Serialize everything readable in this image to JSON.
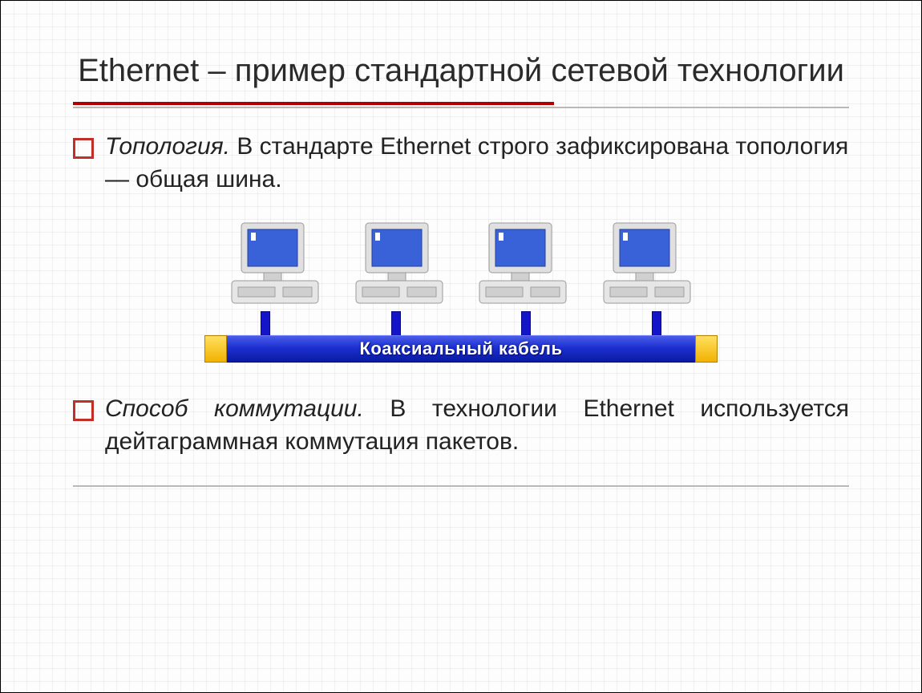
{
  "slide": {
    "title": "Ethernet – пример стандартной сетевой технологии",
    "bullet1": {
      "lead": "Топология.",
      "rest": " В стандарте Ethernet строго зафиксирована топология — общая шина."
    },
    "diagram": {
      "bus_label": "Коаксиальный кабель"
    },
    "bullet2": {
      "lead": "Способ коммутации.",
      "rest": " В технологии Ethernet используется дейтаграммная коммутация пакетов."
    }
  }
}
